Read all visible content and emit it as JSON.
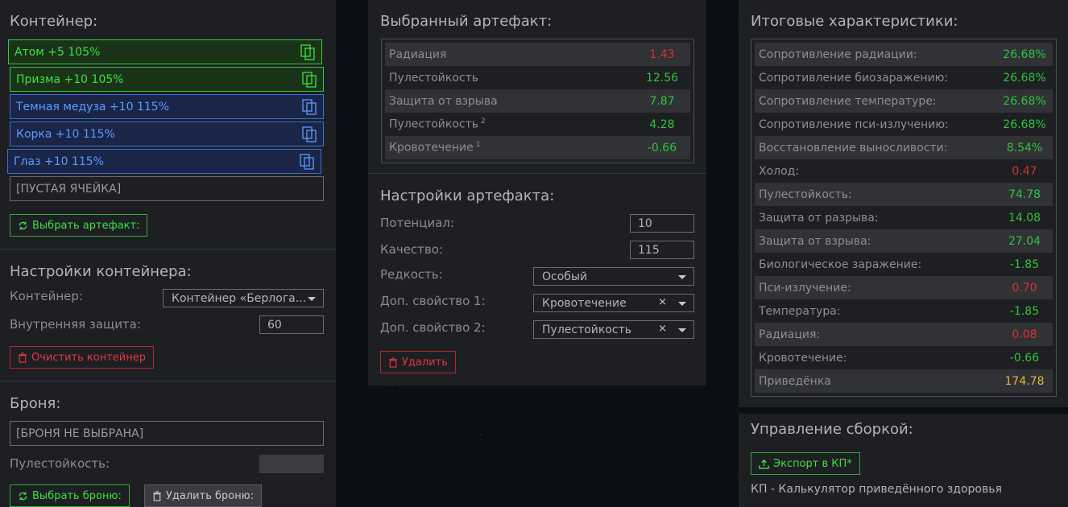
{
  "container": {
    "title": "Контейнер:",
    "slots": [
      {
        "label": "Атом +5 105%",
        "style": "green"
      },
      {
        "label": "Призма +10 105%",
        "style": "green"
      },
      {
        "label": "Темная медуза +10 115%",
        "style": "blue"
      },
      {
        "label": "Корка +10 115%",
        "style": "blue"
      },
      {
        "label": "Глаз +10 115%",
        "style": "blue"
      },
      {
        "label": "[ПУСТАЯ ЯЧЕЙКА]",
        "style": "empty"
      }
    ],
    "choose_button": "Выбрать артефакт:"
  },
  "container_settings": {
    "title": "Настройки контейнера:",
    "container_label": "Контейнер:",
    "container_value": "Контейнер «Берлога...",
    "protection_label": "Внутренняя защита:",
    "protection_value": "60",
    "clear_button": "Очистить контейнер"
  },
  "armor": {
    "title": "Броня:",
    "value": "[БРОНЯ НЕ ВЫБРАНА]",
    "bulletproof_label": "Пулестойкость:",
    "choose_button": "Выбрать броню:",
    "delete_button": "Удалить броню:"
  },
  "selected_artifact": {
    "title": "Выбранный артефакт:",
    "stats": [
      {
        "name": "Радиация",
        "sup": "",
        "value": "1.43",
        "color": "red"
      },
      {
        "name": "Пулестойкость",
        "sup": "",
        "value": "12.56",
        "color": "green"
      },
      {
        "name": "Защита от взрыва",
        "sup": "",
        "value": "7.87",
        "color": "green"
      },
      {
        "name": "Пулестойкость",
        "sup": "2",
        "value": "4.28",
        "color": "green"
      },
      {
        "name": "Кровотечение",
        "sup": "1",
        "value": "-0.66",
        "color": "green"
      }
    ]
  },
  "artifact_settings": {
    "title": "Настройки артефакта:",
    "potential_label": "Потенциал:",
    "potential_value": "10",
    "quality_label": "Качество:",
    "quality_value": "115",
    "rarity_label": "Редкость:",
    "rarity_value": "Особый",
    "extra1_label": "Доп. свойство 1:",
    "extra1_value": "Кровотечение",
    "extra2_label": "Доп. свойство 2:",
    "extra2_value": "Пулестойкость",
    "clear_glyph": "×",
    "delete_button": "Удалить"
  },
  "totals": {
    "title": "Итоговые характеристики:",
    "stats": [
      {
        "name": "Сопротивление радиации:",
        "value": "26.68%",
        "color": "green"
      },
      {
        "name": "Сопротивление биозаражению:",
        "value": "26.68%",
        "color": "green"
      },
      {
        "name": "Сопротивление температуре:",
        "value": "26.68%",
        "color": "green"
      },
      {
        "name": "Сопротивление пси-излучению:",
        "value": "26.68%",
        "color": "green"
      },
      {
        "name": "Восстановление выносливости:",
        "value": "8.54%",
        "color": "green"
      },
      {
        "name": "Холод:",
        "value": "0.47",
        "color": "red"
      },
      {
        "name": "Пулестойкость:",
        "value": "74.78",
        "color": "green"
      },
      {
        "name": "Защита от разрыва:",
        "value": "14.08",
        "color": "green"
      },
      {
        "name": "Защита от взрыва:",
        "value": "27.04",
        "color": "green"
      },
      {
        "name": "Биологическое заражение:",
        "value": "-1.85",
        "color": "green"
      },
      {
        "name": "Пси-излучение:",
        "value": "0.70",
        "color": "red"
      },
      {
        "name": "Температура:",
        "value": "-1.85",
        "color": "green"
      },
      {
        "name": "Радиация:",
        "value": "0.08",
        "color": "red"
      },
      {
        "name": "Кровотечение:",
        "value": "-0.66",
        "color": "green"
      },
      {
        "name": "Приведёнка",
        "value": "174.78",
        "color": "gold"
      }
    ]
  },
  "build": {
    "title": "Управление сборкой:",
    "export_button": "Экспорт в КП*",
    "footnote": "КП - Калькулятор приведённого здоровья"
  },
  "icons": [
    "copy-icon",
    "refresh-icon",
    "trash-icon",
    "upload-icon",
    "chevron-down-icon",
    "clear-icon"
  ]
}
